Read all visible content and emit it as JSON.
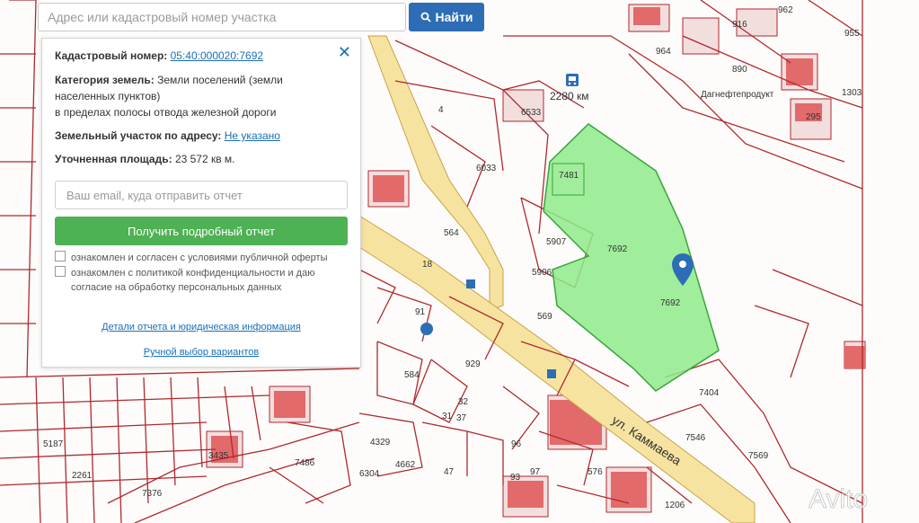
{
  "search": {
    "placeholder": "Адрес или кадастровый номер участка",
    "button_label": "Найти"
  },
  "panel": {
    "cadastral_label": "Кадастровый номер:",
    "cadastral_value": "05:40:000020:7692",
    "category_label": "Категория земель:",
    "category_value_1": "Земли поселений (земли",
    "category_value_2": "населенных пунктов)",
    "category_value_3": "в пределах полосы отвода железной дороги",
    "address_label": "Земельный участок по адресу:",
    "address_value": "Не указано",
    "area_label": "Уточненная площадь:",
    "area_value": "23 572 кв м.",
    "email_placeholder": "Ваш email, куда отправить отчет",
    "report_button": "Получить подробный отчет",
    "consent_1": "ознакомлен и согласен с условиями публичной оферты",
    "consent_2a": "ознакомлен с политикой конфиденциальности и даю",
    "consent_2b": "согласие на обработку персональных данных",
    "details_link": "Детали отчета и юридическая информация",
    "manual_link": "Ручной выбор вариантов"
  },
  "map": {
    "parcel_colors": {
      "highlight": "#8fea8a",
      "boundary": "#b0282e",
      "building": "#e15a5a",
      "road": "#f6e3a0"
    },
    "street_label": "ул. Каммаева",
    "station_label": "2280 км",
    "company_label": "Дагнефтепродукт",
    "highlight_label": "7692",
    "highlight_label_2": "7692",
    "parcel_labels": [
      "4",
      "6033",
      "6533",
      "5907",
      "5906",
      "569",
      "7404",
      "7546",
      "7569",
      "929",
      "584",
      "91",
      "7486",
      "7376",
      "37",
      "31",
      "32",
      "47",
      "576",
      "1206",
      "890",
      "295",
      "916",
      "964",
      "962",
      "955",
      "1303",
      "18",
      "96",
      "93",
      "97",
      "4329",
      "4662",
      "6304",
      "5187",
      "2261",
      "3435",
      "7481",
      "564"
    ],
    "watermark": "Avito"
  }
}
